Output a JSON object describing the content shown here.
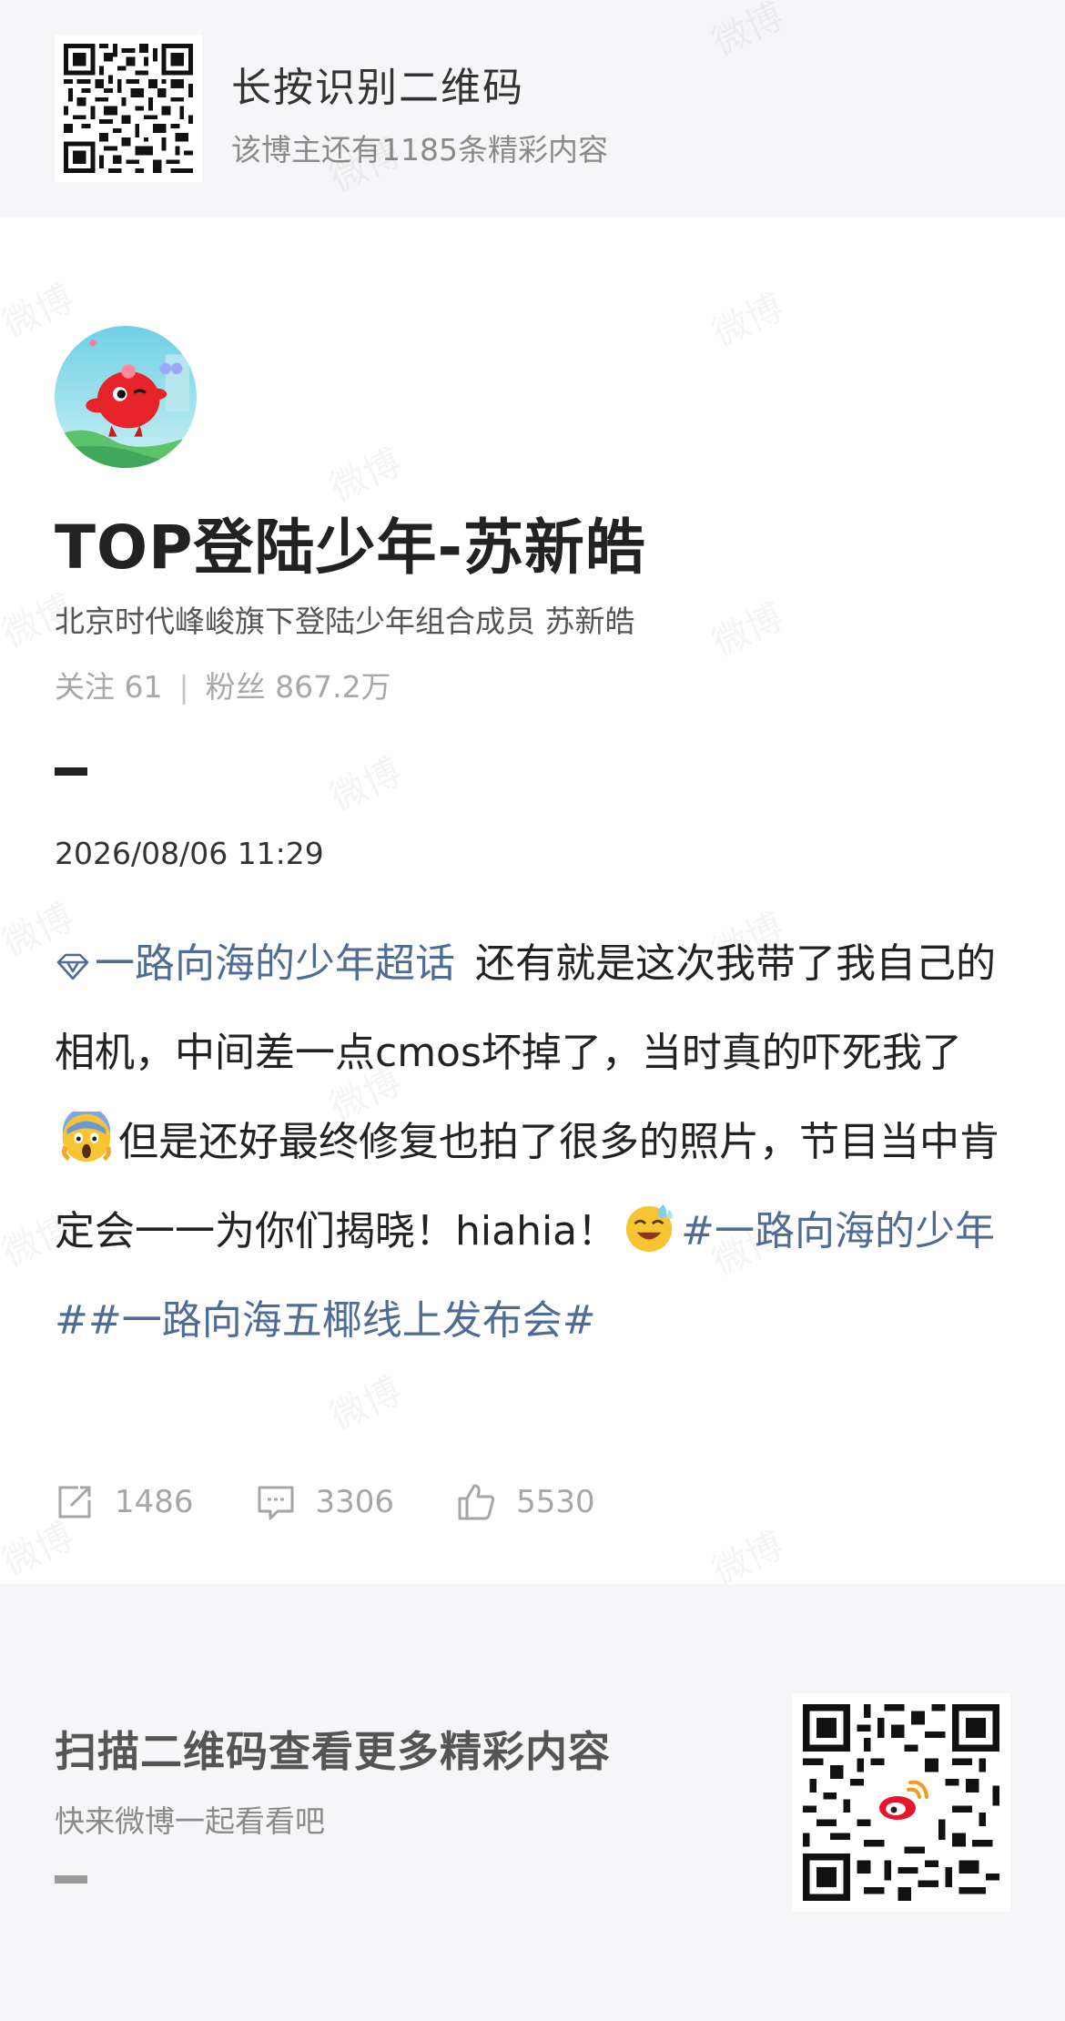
{
  "top_banner": {
    "title": "长按识别二维码",
    "subtitle": "该博主还有1185条精彩内容"
  },
  "profile": {
    "name": "TOP登陆少年-苏新皓",
    "description": "北京时代峰峻旗下登陆少年组合成员 苏新皓",
    "following_label": "关注 61",
    "followers_label": "粉丝 867.2万",
    "separator": "|"
  },
  "post": {
    "timestamp": "2026/08/06 11:29",
    "topic": "一路向海的少年超话",
    "text_1": "还有就是这次我带了我自己的相机，中间差一点cmos坏掉了，当时真的吓死我了",
    "text_2": "但是还好最终修复也拍了很多的照片，节目当中肯定会一一为你们揭晓！hiahia！",
    "hashtag_1": "#一路向海的少年#",
    "hashtag_2": "#一路向海五椰线上发布会#",
    "emoji_1": "scream-emoji",
    "emoji_2": "laughing-sweat-emoji"
  },
  "actions": {
    "repost_count": "1486",
    "comment_count": "3306",
    "like_count": "5530"
  },
  "bottom_banner": {
    "title": "扫描二维码查看更多精彩内容",
    "subtitle": "快来微博一起看看吧"
  },
  "watermark": "微博",
  "colors": {
    "banner_bg": "#f6f6f8",
    "link": "#4f6c96",
    "muted": "#a6a6a6",
    "weibo_red": "#e6162d"
  }
}
